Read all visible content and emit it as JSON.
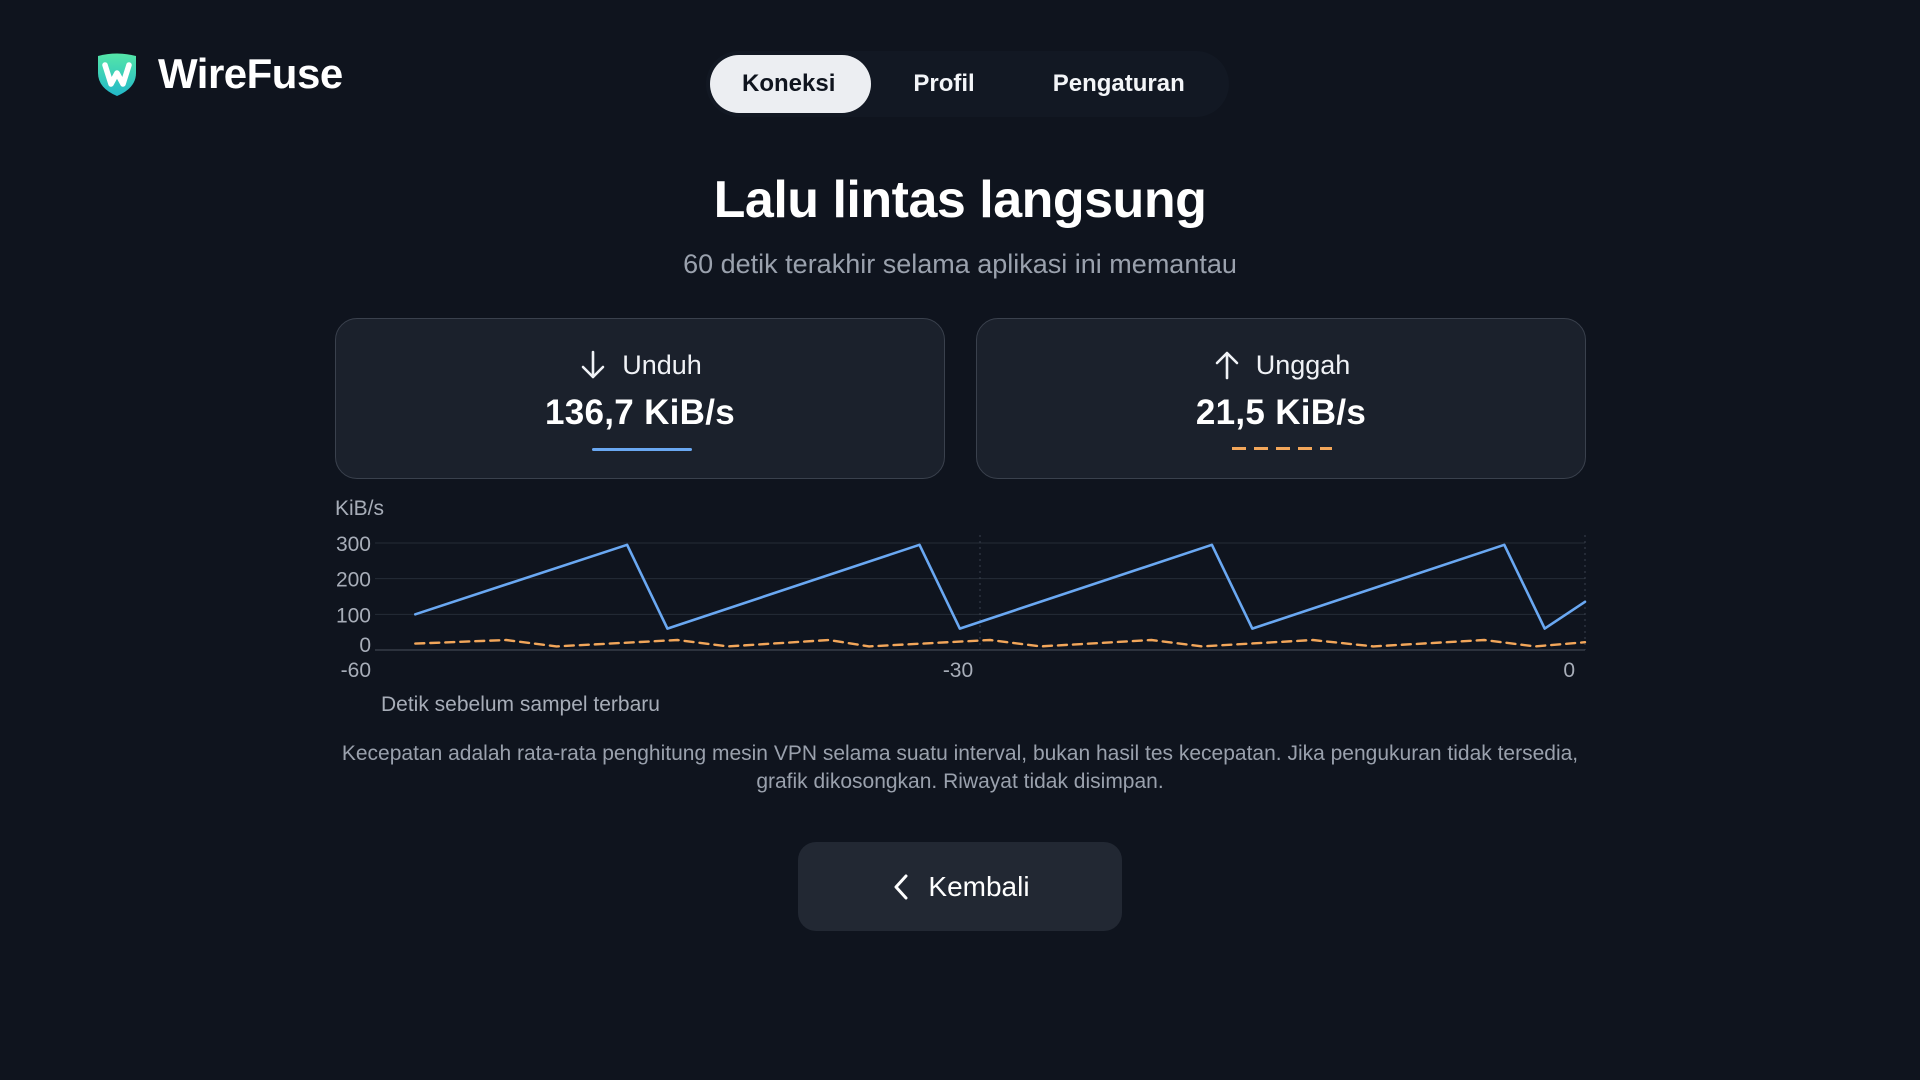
{
  "app": {
    "name": "WireFuse"
  },
  "colors": {
    "background": "#0f141e",
    "brand_green": "#3ddc97",
    "download_line": "#6aa8f2",
    "upload_line": "#f2a65a",
    "card_bg": "#1b212c"
  },
  "tabs": [
    {
      "label": "Koneksi",
      "active": true
    },
    {
      "label": "Profil",
      "active": false
    },
    {
      "label": "Pengaturan",
      "active": false
    }
  ],
  "header": {
    "title": "Lalu lintas langsung",
    "subtitle": "60 detik terakhir selama aplikasi ini memantau"
  },
  "stats": {
    "download": {
      "label": "Unduh",
      "value": "136,7 KiB/s",
      "icon": "arrow-down-icon"
    },
    "upload": {
      "label": "Unggah",
      "value": "21,5 KiB/s",
      "icon": "arrow-up-icon"
    }
  },
  "chart_data": {
    "type": "line",
    "ylabel": "KiB/s",
    "xlabel": "Detik sebelum sampel terbaru",
    "xlim": [
      -60,
      0
    ],
    "ylim": [
      0,
      300
    ],
    "y_ticks": [
      "300",
      "200",
      "100",
      "0"
    ],
    "x_ticks": [
      "-60",
      "-30",
      "0"
    ],
    "grid": true,
    "series": [
      {
        "style": "solid",
        "color": "#6aa8f2",
        "x": [
          -58,
          -47.5,
          -45.5,
          -33,
          -31,
          -18.5,
          -16.5,
          -4,
          -2,
          0
        ],
        "y": [
          100,
          295,
          60,
          295,
          60,
          295,
          60,
          295,
          60,
          135
        ]
      },
      {
        "style": "dashed",
        "color": "#f2a65a",
        "x": [
          -58,
          -53.5,
          -51,
          -45,
          -42.5,
          -37.5,
          -35.5,
          -29.5,
          -27,
          -21.5,
          -19,
          -13.5,
          -10.5,
          -5,
          -2.5,
          0
        ],
        "y": [
          18,
          28,
          10,
          28,
          10,
          28,
          10,
          28,
          10,
          28,
          10,
          28,
          10,
          28,
          10,
          22
        ]
      }
    ]
  },
  "note": "Kecepatan adalah rata-rata penghitung mesin VPN selama suatu interval, bukan hasil tes kecepatan. Jika pengukuran tidak tersedia, grafik dikosongkan. Riwayat tidak disimpan.",
  "back_button": {
    "label": "Kembali"
  }
}
